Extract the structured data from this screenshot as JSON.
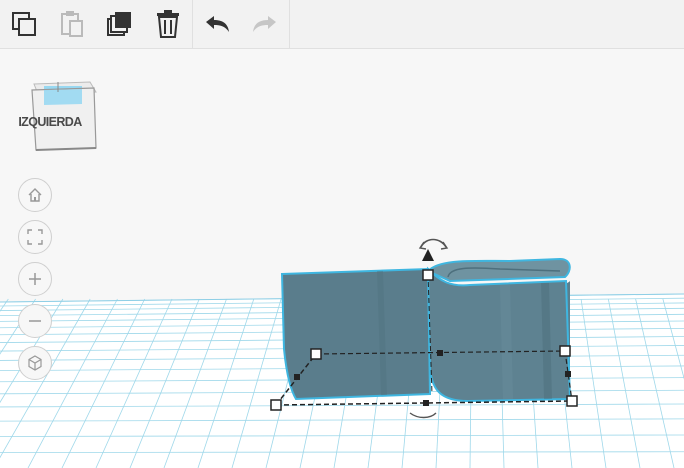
{
  "toolbar": {
    "edit_tools": [
      {
        "name": "copy",
        "icon": "copy-icon",
        "enabled": true
      },
      {
        "name": "paste",
        "icon": "paste-icon",
        "enabled": false
      },
      {
        "name": "duplicate",
        "icon": "duplicate-icon",
        "enabled": true
      },
      {
        "name": "delete",
        "icon": "trash-icon",
        "enabled": true
      }
    ],
    "history_tools": [
      {
        "name": "undo",
        "icon": "undo-icon",
        "enabled": true
      },
      {
        "name": "redo",
        "icon": "redo-icon",
        "enabled": false
      }
    ]
  },
  "viewcube": {
    "face_label": "IZQUIERDA"
  },
  "nav_controls": [
    {
      "name": "home-view",
      "icon": "home-icon"
    },
    {
      "name": "fit-view",
      "icon": "fit-to-view-icon"
    },
    {
      "name": "zoom-in",
      "icon": "plus-icon"
    },
    {
      "name": "zoom-out",
      "icon": "minus-icon"
    },
    {
      "name": "projection",
      "icon": "cube-icon"
    }
  ],
  "colors": {
    "grid_line": "#9fd8ea",
    "grid_bg": "#ffffff",
    "shape_fill": "#5b7f8e",
    "selection_outline": "#3fb6e0",
    "toolbar_bg": "#f2f2f2"
  }
}
